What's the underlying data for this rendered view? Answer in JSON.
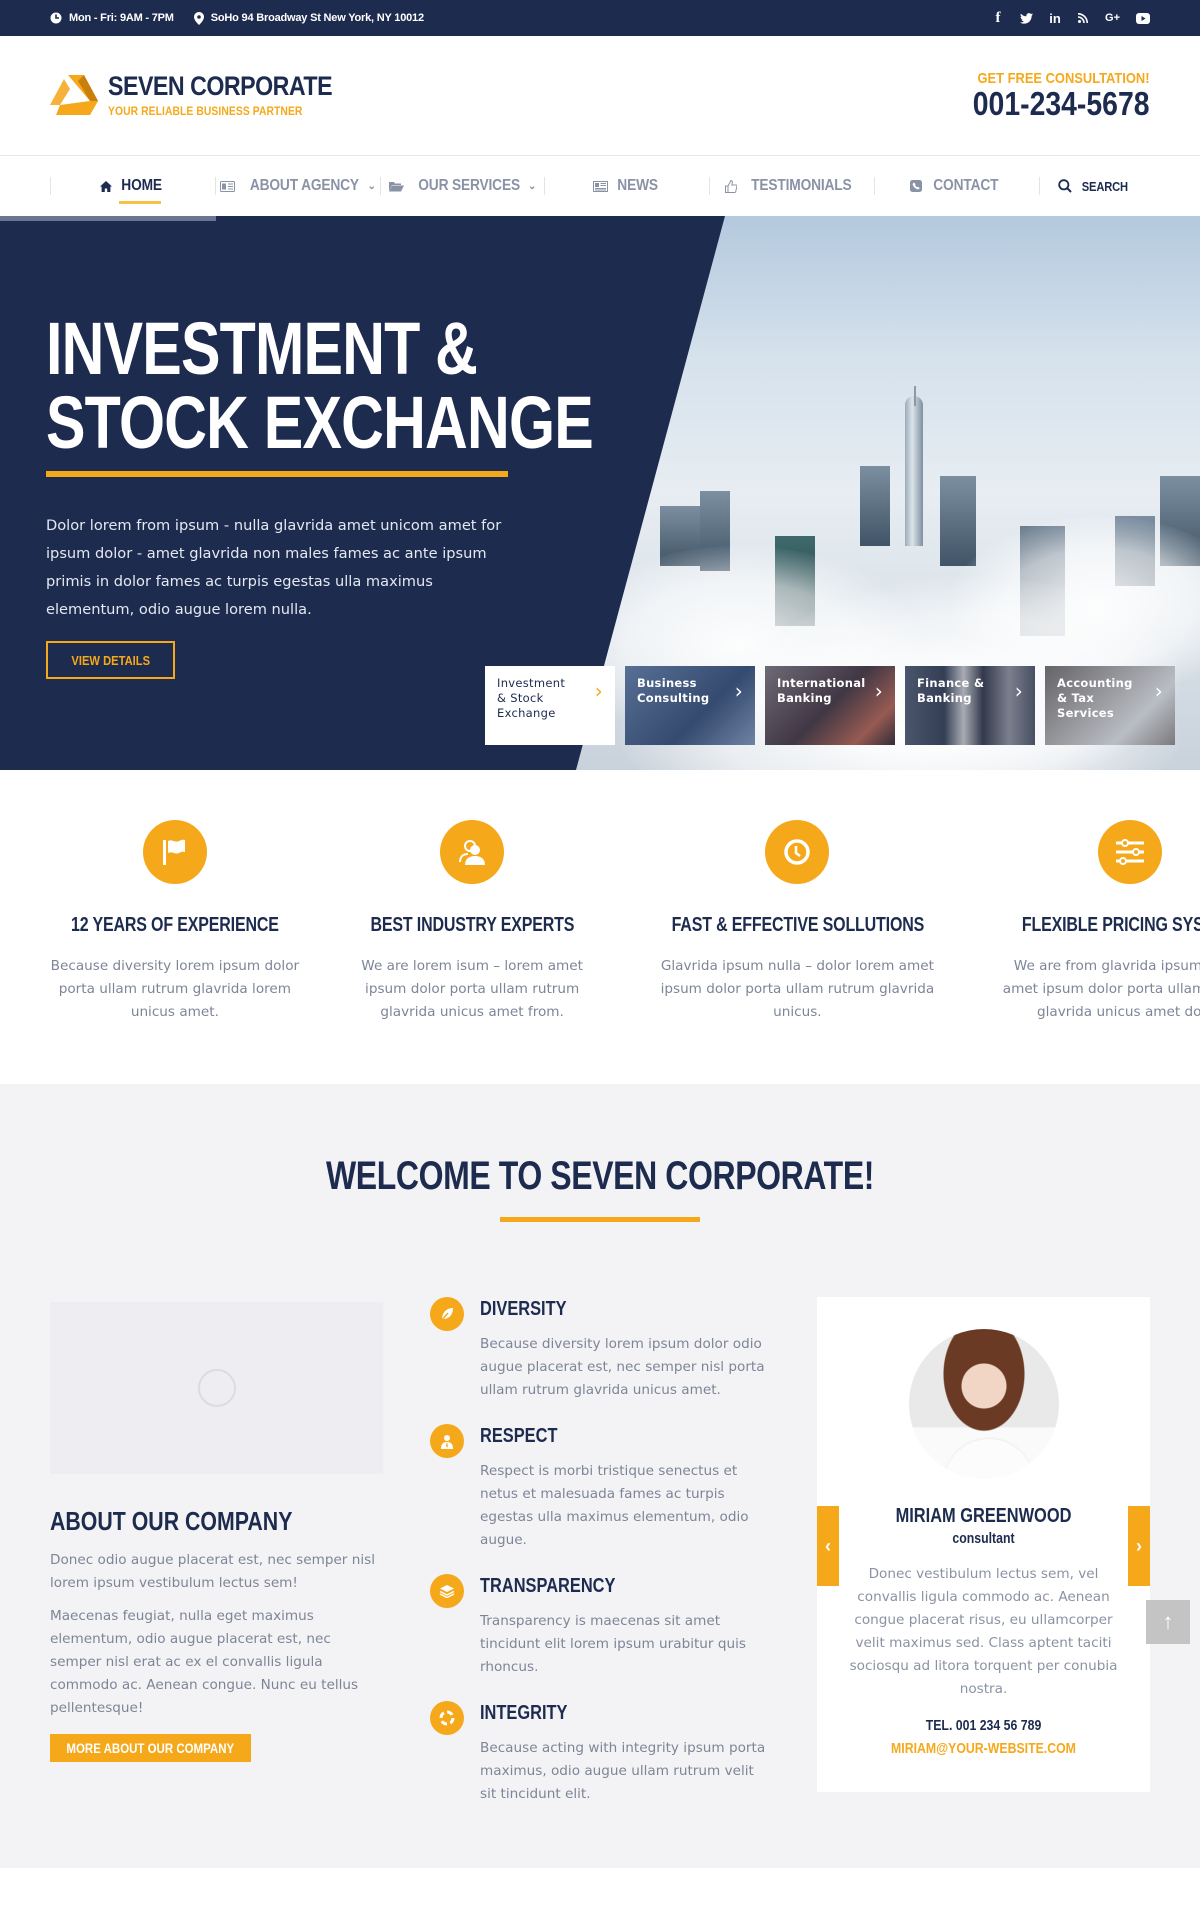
{
  "topbar": {
    "hours": "Mon - Fri: 9AM - 7PM",
    "address": "SoHo 94 Broadway St New York, NY 10012",
    "social": [
      {
        "icon": "facebook-icon",
        "glyph": "f"
      },
      {
        "icon": "twitter-icon",
        "glyph": "🐦"
      },
      {
        "icon": "linkedin-icon",
        "glyph": "in"
      },
      {
        "icon": "rss-icon",
        "glyph": "◔"
      },
      {
        "icon": "google-plus-icon",
        "glyph": "G+"
      },
      {
        "icon": "youtube-icon",
        "glyph": "▶"
      }
    ]
  },
  "header": {
    "brand": "SEVEN CORPORATE",
    "tagline": "YOUR RELIABLE BUSINESS PARTNER",
    "cta": "GET FREE CONSULTATION!",
    "phone": "001-234-5678"
  },
  "nav": {
    "items": [
      {
        "label": "HOME",
        "icon": "home-icon",
        "active": true
      },
      {
        "label": "ABOUT AGENCY",
        "icon": "id-card-icon",
        "dropdown": true
      },
      {
        "label": "OUR SERVICES",
        "icon": "folder-open-icon",
        "dropdown": true
      },
      {
        "label": "NEWS",
        "icon": "newspaper-icon"
      },
      {
        "label": "TESTIMONIALS",
        "icon": "thumbs-up-icon"
      },
      {
        "label": "CONTACT",
        "icon": "phone-square-icon"
      }
    ],
    "search_label": "SEARCH"
  },
  "hero": {
    "title_line1": "INVESTMENT &",
    "title_line2": "STOCK EXCHANGE",
    "description": "Dolor lorem from ipsum - nulla glavrida amet unicom amet for ipsum dolor - amet glavrida non males fames ac ante ipsum primis in dolor fames ac turpis egestas ulla maximus elementum, odio augue lorem nulla.",
    "button": "VIEW DETAILS",
    "slide_progress": 0.18,
    "slides": [
      {
        "label": "Investment & Stock Exchange",
        "active": true
      },
      {
        "label": "Business Consulting"
      },
      {
        "label": "International Banking"
      },
      {
        "label": "Finance & Banking"
      },
      {
        "label": "Accounting & Tax Services"
      }
    ]
  },
  "features": [
    {
      "icon": "flag-icon",
      "title": "12 YEARS OF EXPERIENCE",
      "text": "Because diversity lorem ipsum dolor porta ullam rutrum glavrida lorem unicus amet."
    },
    {
      "icon": "users-icon",
      "title": "BEST INDUSTRY EXPERTS",
      "text": "We are lorem isum –  lorem amet ipsum dolor porta ullam rutrum glavrida unicus amet from."
    },
    {
      "icon": "clock-icon",
      "title": "FAST & EFFECTIVE SOLLUTIONS",
      "text": "Glavrida ipsum nulla – dolor lorem amet  ipsum dolor porta ullam rutrum glavrida unicus."
    },
    {
      "icon": "sliders-icon",
      "title": "FLEXIBLE PRICING SYSTEM",
      "text": "We are from glavrida ipsum lorem amet  ipsum dolor porta ullam rutrum glavrida unicus amet dolor."
    }
  ],
  "welcome": {
    "title": "WELCOME TO SEVEN CORPORATE!",
    "about": {
      "title": "ABOUT OUR COMPANY",
      "p1": "Donec odio augue placerat est, nec semper nisl lorem ipsum vestibulum lectus sem!",
      "p2": "Maecenas feugiat, nulla eget maximus elementum, odio augue placerat est, nec semper nisl erat ac ex el convallis ligula commodo ac. Aenean congue. Nunc eu tellus pellentesque!",
      "button": "MORE ABOUT OUR COMPANY"
    },
    "values": [
      {
        "icon": "leaf-icon",
        "title": "DIVERSITY",
        "text": "Because diversity lorem ipsum dolor odio augue placerat est, nec semper nisl porta ullam rutrum glavrida unicus amet."
      },
      {
        "icon": "user-tie-icon",
        "title": "RESPECT",
        "text": "Respect is morbi tristique senectus et netus et malesuada fames ac turpis egestas ulla maximus elementum, odio augue."
      },
      {
        "icon": "layers-icon",
        "title": "TRANSPARENCY",
        "text": "Transparency is maecenas sit amet tincidunt elit lorem ipsum urabitur quis rhoncus."
      },
      {
        "icon": "life-ring-icon",
        "title": "INTEGRITY",
        "text": "Because acting with integrity ipsum porta maximus, odio augue ullam rutrum velit sit tincidunt elit."
      }
    ],
    "team": {
      "name": "MIRIAM GREENWOOD",
      "role": "consultant",
      "bio": "Donec vestibulum lectus sem, vel convallis ligula commodo ac. Aenean congue placerat risus, eu ullamcorper velit maximus sed. Class aptent taciti sociosqu ad litora torquent per conubia nostra.",
      "tel": "TEL. 001 234 56 789",
      "email": "MIRIAM@YOUR-WEBSITE.COM",
      "prev_glyph": "‹",
      "next_glyph": "›"
    }
  },
  "scroll_top_glyph": "↑",
  "colors": {
    "navy": "#1d2b4f",
    "accent": "#f6a81b",
    "muted_text": "#7d8597",
    "section_bg": "#f3f3f5"
  }
}
